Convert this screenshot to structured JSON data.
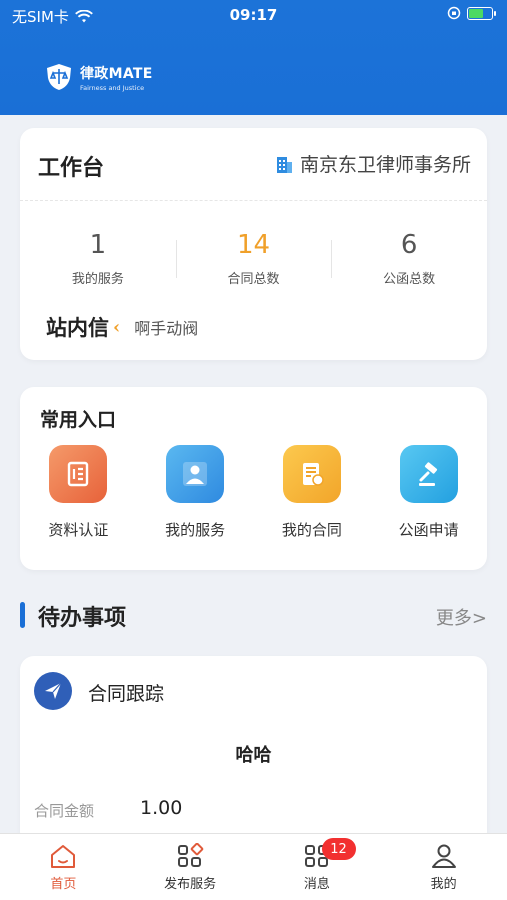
{
  "status_bar": {
    "carrier": "无SIM卡",
    "time": "09:17"
  },
  "brand": {
    "name": "律政MATE",
    "tagline": "Fairness and Justice"
  },
  "workbench": {
    "title": "工作台",
    "firm": "南京东卫律师事务所",
    "stats": [
      {
        "value": "1",
        "label": "我的服务"
      },
      {
        "value": "14",
        "label": "合同总数"
      },
      {
        "value": "6",
        "label": "公函总数"
      }
    ],
    "message_logo": "站内信",
    "message_text": "啊手动阀"
  },
  "entries": {
    "title": "常用入口",
    "items": [
      {
        "label": "资料认证",
        "icon": "document-icon",
        "color": "#ee7a4c"
      },
      {
        "label": "我的服务",
        "icon": "person-icon",
        "color": "#3aa0e8"
      },
      {
        "label": "我的合同",
        "icon": "contract-icon",
        "color": "#f5b83a"
      },
      {
        "label": "公函申请",
        "icon": "gavel-icon",
        "color": "#2fb0e8"
      }
    ]
  },
  "todo": {
    "title": "待办事项",
    "more": "更多>"
  },
  "tracking": {
    "title": "合同跟踪",
    "name": "哈哈",
    "amount_label": "合同金额",
    "amount_value": "1.00"
  },
  "tabbar": {
    "items": [
      {
        "label": "首页",
        "active": true
      },
      {
        "label": "发布服务"
      },
      {
        "label": "消息",
        "badge": "12"
      },
      {
        "label": "我的"
      }
    ]
  },
  "colors": {
    "brand_blue": "#1a6fd6",
    "accent_orange": "#f0a02a",
    "active_tab": "#e05a3a",
    "badge_red": "#f23030"
  }
}
